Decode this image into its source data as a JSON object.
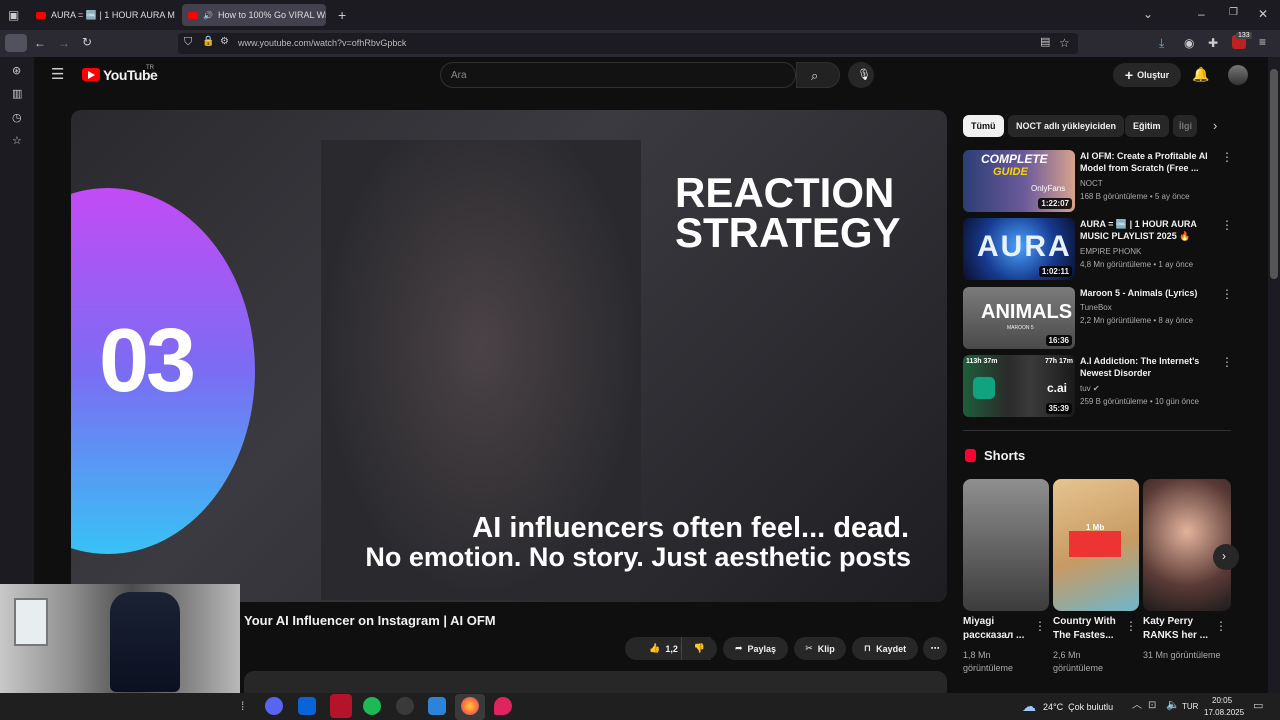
{
  "browser": {
    "tabs": [
      {
        "title": "AURA = 🆒 | 1 HOUR AURA M…",
        "close": "✕"
      },
      {
        "title": "How to 100% Go VIRAL Wi…",
        "close": "✕"
      }
    ],
    "new_tab": "+",
    "url": "www.youtube.com/watch?v=ofhRbvGpbck",
    "extension_badge": "133"
  },
  "youtube": {
    "logo_text": "YouTube",
    "region": "TR",
    "search_placeholder": "Ara",
    "create_label": "Oluştur",
    "video": {
      "overlay_heading": [
        "REACTION",
        "STRATEGY"
      ],
      "overlay_number": "03",
      "subtitle": [
        "AI influencers often feel... dead.",
        "No emotion. No story. Just aesthetic posts"
      ],
      "title": "Your AI Influencer on Instagram | AI OFM",
      "likes": "1,2 B",
      "share": "Paylaş",
      "clip": "Klip",
      "save": "Kaydet",
      "more": "⋯"
    },
    "chips": [
      "Tümü",
      "NOCT adlı yükleyiciden",
      "Eğitim",
      "İlgi"
    ],
    "recommendations": [
      {
        "title": "AI OFM: Create a Profitable AI Model from Scratch (Free ...",
        "channel": "NOCT",
        "meta": "168 B görüntüleme • 5 ay önce",
        "duration": "1:22:07",
        "thumb_text": [
          "COMPLETE",
          "GUIDE"
        ],
        "thumb_caption": "OnlyFans"
      },
      {
        "title": "AURA = 🆒 | 1 HOUR AURA MUSIC PLAYLIST 2025 🔥",
        "channel": "EMPIRE PHONK",
        "meta": "4,8 Mn görüntüleme • 1 ay önce",
        "duration": "1:02:11",
        "thumb_text": [
          "AURA"
        ]
      },
      {
        "title": "Maroon 5 - Animals (Lyrics)",
        "channel": "TuneBox",
        "meta": "2,2 Mn görüntüleme • 8 ay önce",
        "duration": "16:36",
        "thumb_text": [
          "ANIMALS"
        ],
        "thumb_caption": "MAROON 5"
      },
      {
        "title": "A.I Addiction: The Internet's Newest Disorder",
        "channel": "tuv",
        "meta": "259 B görüntüleme • 10 gün önce",
        "duration": "35:39",
        "thumb_text": [
          "113h 37m",
          "77h 17m",
          "c.ai"
        ]
      }
    ],
    "shorts_heading": "Shorts",
    "shorts": [
      {
        "title": "Miyagi рассказал ...",
        "views": "1,8 Mn görüntüleme"
      },
      {
        "title": "Country With The Fastes...",
        "views": "2,6 Mn görüntüleme",
        "map_label": "1 Mb"
      },
      {
        "title": "Katy Perry RANKS her ...",
        "views": "31 Mn görüntüleme"
      }
    ]
  },
  "taskbar": {
    "weather": "24°C  Çok bulutlu",
    "language": "TUR",
    "time": "20:05",
    "date": "17.08.2025"
  }
}
